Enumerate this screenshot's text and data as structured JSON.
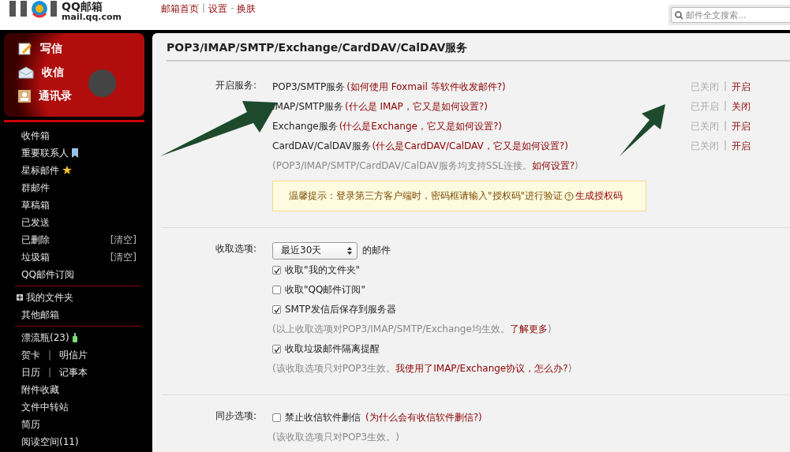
{
  "header": {
    "logo_title": "QQ邮箱",
    "logo_domain": "mail.qq.com",
    "links": [
      {
        "label": "邮箱首页",
        "kind": "link"
      },
      {
        "label": "|",
        "kind": "sep"
      },
      {
        "label": "设置",
        "kind": "link"
      },
      {
        "label": "-",
        "kind": "sep"
      },
      {
        "label": "换肤",
        "kind": "link"
      }
    ],
    "search": {
      "placeholder": "邮件全文搜索..."
    }
  },
  "sidebar": {
    "actions": [
      {
        "label": "写信",
        "kind": "compose"
      },
      {
        "label": "收信",
        "kind": "inbox"
      },
      {
        "label": "通讯录",
        "kind": "contacts"
      }
    ],
    "groups": [
      [
        {
          "kind": "plain",
          "label": "收件箱"
        },
        {
          "kind": "bookmark",
          "label": "重要联系人"
        },
        {
          "kind": "star",
          "label": "星标邮件"
        },
        {
          "kind": "plain",
          "label": "群邮件"
        },
        {
          "kind": "plain",
          "label": "草稿箱"
        },
        {
          "kind": "plain",
          "label": "已发送"
        },
        {
          "kind": "clear",
          "label": "已删除",
          "action": "[清空]"
        },
        {
          "kind": "clear",
          "label": "垃圾箱",
          "action": "[清空]"
        },
        {
          "kind": "plain",
          "label": "QQ邮件订阅"
        }
      ],
      [
        {
          "kind": "folder",
          "label": "我的文件夹",
          "expanded": false
        },
        {
          "kind": "plain",
          "label": "其他邮箱"
        }
      ],
      [
        {
          "kind": "bottle",
          "label": "漂流瓶(23)"
        },
        {
          "kind": "pair",
          "links": [
            "贺卡",
            "明信片"
          ],
          "sep": "|"
        },
        {
          "kind": "pair",
          "links": [
            "日历",
            "记事本"
          ],
          "sep": "|"
        },
        {
          "kind": "plain",
          "label": "附件收藏"
        },
        {
          "kind": "plain",
          "label": "文件中转站"
        },
        {
          "kind": "plain",
          "label": "简历"
        },
        {
          "kind": "plain",
          "label": "阅读空间(11)"
        }
      ]
    ]
  },
  "page": {
    "title": "POP3/IMAP/SMTP/Exchange/CardDAV/CalDAV服务",
    "services": {
      "label": "开启服务:",
      "items": [
        {
          "name": "POP3/SMTP服务",
          "help": "(如何使用 Foxmail 等软件收发邮件?)",
          "status": "已关闭",
          "sep": "|",
          "action": "开启"
        },
        {
          "name": "IMAP/SMTP服务",
          "help": "(什么是 IMAP，它又是如何设置?)",
          "status": "已开启",
          "sep": "|",
          "action": "关闭"
        },
        {
          "name": "Exchange服务",
          "help": "(什么是Exchange，它又是如何设置?)",
          "status": "已关闭",
          "sep": "|",
          "action": "开启"
        },
        {
          "name": "CardDAV/CalDAV服务",
          "help": "(什么是CardDAV/CalDAV，它又是如何设置?)",
          "status": "已关闭",
          "sep": "|",
          "action": "开启"
        }
      ],
      "note": {
        "text": "(POP3/IMAP/SMTP/CardDAV/CalDAV服务均支持SSL连接。",
        "link": "如何设置?",
        "end": ")"
      },
      "tip": {
        "text": "温馨提示：登录第三方客户端时，密码框请输入\"授权码\"进行验证",
        "link": "生成授权码"
      }
    },
    "receive": {
      "label": "收取选项:",
      "select": "最近30天",
      "suffix": "的邮件",
      "items": [
        {
          "kind": "check",
          "label": "收取\"我的文件夹\"",
          "checked": true
        },
        {
          "kind": "check",
          "label": "收取\"QQ邮件订阅\"",
          "checked": false
        },
        {
          "kind": "check",
          "label": "SMTP发信后保存到服务器",
          "checked": true
        },
        {
          "kind": "note",
          "text": "(以上收取选项对POP3/IMAP/SMTP/Exchange均生效。",
          "link": "了解更多",
          "end": ")"
        },
        {
          "kind": "check",
          "label": "收取垃圾邮件隔离提醒",
          "checked": true
        },
        {
          "kind": "note",
          "text": "(该收取选项只对POP3生效。",
          "link": "我使用了IMAP/Exchange协议，怎么办?",
          "end": ")"
        }
      ]
    },
    "sync": {
      "label": "同步选项:",
      "items": [
        {
          "kind": "check",
          "label": "禁止收信软件删信",
          "checked": false,
          "link": "(为什么会有收信软件删信?)"
        },
        {
          "kind": "note",
          "text": "(该收取选项只对POP3生效。)"
        }
      ]
    }
  }
}
